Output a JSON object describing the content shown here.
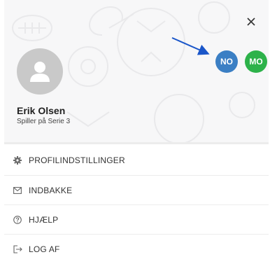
{
  "profile": {
    "name": "Erik Olsen",
    "subtitle": "Spiller på Serie 3"
  },
  "badges": [
    {
      "label": "NO",
      "color": "#3b7fc4"
    },
    {
      "label": "MO",
      "color": "#2db24a"
    }
  ],
  "menu": {
    "items": [
      {
        "label": "PROFILINDSTILLINGER",
        "icon": "gear-icon"
      },
      {
        "label": "INDBAKKE",
        "icon": "envelope-icon"
      },
      {
        "label": "HJÆLP",
        "icon": "help-circle-icon"
      },
      {
        "label": "LOG AF",
        "icon": "logout-icon"
      }
    ]
  },
  "colors": {
    "arrow": "#1a56c9",
    "avatar_bg": "#c9c9c9",
    "header_bg": "#f7f7f8"
  }
}
